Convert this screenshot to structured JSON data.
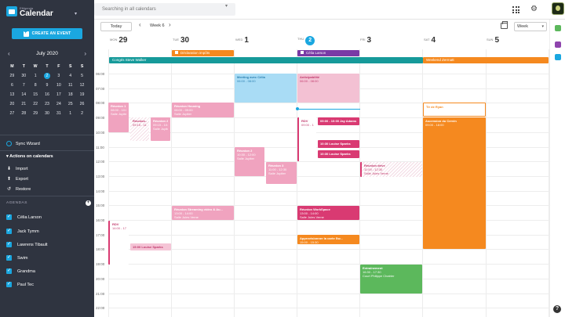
{
  "app": {
    "brand_small": "EMgenda",
    "title": "Calendar"
  },
  "sidebar": {
    "create_label": "CREATE AN EVENT",
    "mini_calendar": {
      "month_label": "July 2020",
      "weekdays": [
        "M",
        "T",
        "W",
        "T",
        "F",
        "S",
        "S"
      ],
      "days": [
        "29",
        "30",
        "1",
        "2",
        "3",
        "4",
        "5",
        "6",
        "7",
        "8",
        "9",
        "10",
        "11",
        "12",
        "13",
        "14",
        "15",
        "16",
        "17",
        "18",
        "19",
        "20",
        "21",
        "22",
        "23",
        "24",
        "25",
        "26",
        "27",
        "28",
        "29",
        "30",
        "31",
        "1",
        "2"
      ],
      "today": "2"
    },
    "sync_label": "Sync Wizard",
    "actions_title": "Actions on calendars",
    "actions": [
      "Import",
      "Export",
      "Restore"
    ],
    "agendas_title": "AGENDAS",
    "agendas": [
      "Célia Larson",
      "Jack Tymm",
      "Lawrens Tibault",
      "Swim",
      "Grandma",
      "Paul Tec"
    ]
  },
  "topbar": {
    "search_placeholder": "Searching in all calendars"
  },
  "toolbar": {
    "today_label": "Today",
    "week_label": "Week 6",
    "view_value": "Week"
  },
  "calendar": {
    "days": [
      {
        "name": "MON",
        "num": "29"
      },
      {
        "name": "TUE",
        "num": "30"
      },
      {
        "name": "WED",
        "num": "1"
      },
      {
        "name": "THU",
        "num": "2",
        "today": true
      },
      {
        "name": "FRI",
        "num": "3"
      },
      {
        "name": "SAT",
        "num": "4"
      },
      {
        "name": "SUN",
        "num": "5"
      }
    ],
    "hours": [
      "06:00",
      "07:00",
      "08:00",
      "09:00",
      "10:00",
      "11:00",
      "12:00",
      "13:00",
      "14:00",
      "15:00",
      "16:00",
      "17:00",
      "18:00",
      "19:00",
      "20:00",
      "21:00",
      "22:00"
    ],
    "allday": [
      {
        "label": "Déclaration impôts",
        "color": "#f5891f"
      },
      {
        "label": "Célia Larson",
        "color": "#7a3aa6"
      },
      {
        "label": "Congés Steve Walker",
        "color": "#169a9a"
      },
      {
        "label": "Weekend Zermatt",
        "color": "#f5891f"
      }
    ],
    "events": [
      {
        "title": "Réunion 1",
        "sub": "08:00 - 10:00",
        "sub2": "Salle Jupiter"
      },
      {
        "title": "Réunion...",
        "sub": "09:15 - 11:00"
      },
      {
        "title": "Réunion 2",
        "sub": "09:15 - 10:30",
        "sub2": "Salle Jupiter"
      },
      {
        "title": "Réunion Housing",
        "sub": "08:00 - 09:00",
        "sub2": "Salle Jupiter"
      },
      {
        "title": "Meeting avec Célia",
        "sub": "06:00 - 08:00"
      },
      {
        "title": "Réunion 2",
        "sub": "10:30 - 12:00",
        "sub2": "Salle Jupiter"
      },
      {
        "title": "Réunion 3",
        "sub": "11:00 - 12:30",
        "sub2": "Salle Jupiter"
      },
      {
        "title": "Anticipabilité",
        "sub": "06:00 - 08:00"
      },
      {
        "title": "RDV",
        "sub": "09:00 - 12:00"
      },
      {
        "title": "09:00 - 10:00 Jay Adams"
      },
      {
        "title": "10:30 Louise Sparks"
      },
      {
        "title": "10:30 Louise Sparks"
      },
      {
        "title": "Réunion drive",
        "sub": "11:00 - 12:30",
        "sub2": "Salle Jules Verne"
      },
      {
        "title": "Tir de Ryan"
      },
      {
        "title": "Ascension du Cervin",
        "sub": "09:00 - 18:00"
      },
      {
        "title": "Réunion Streaming video & Au...",
        "sub": "13:00 - 14:00",
        "sub2": "Salle Jules Verne"
      },
      {
        "title": "RDV",
        "sub": "14:00 - 17:00"
      },
      {
        "title": "15:00 Louise Sparks"
      },
      {
        "title": "Réunion WorkSpace",
        "sub": "13:00 - 14:00",
        "sub2": "Salle Jules Verne"
      },
      {
        "title": "Approvisionner la carte Sw...",
        "sub": "15:00 - 15:30"
      },
      {
        "title": "Entraînement",
        "sub": "16:30 - 17:30",
        "sub2": "Court Philippe Chatrier"
      }
    ]
  }
}
